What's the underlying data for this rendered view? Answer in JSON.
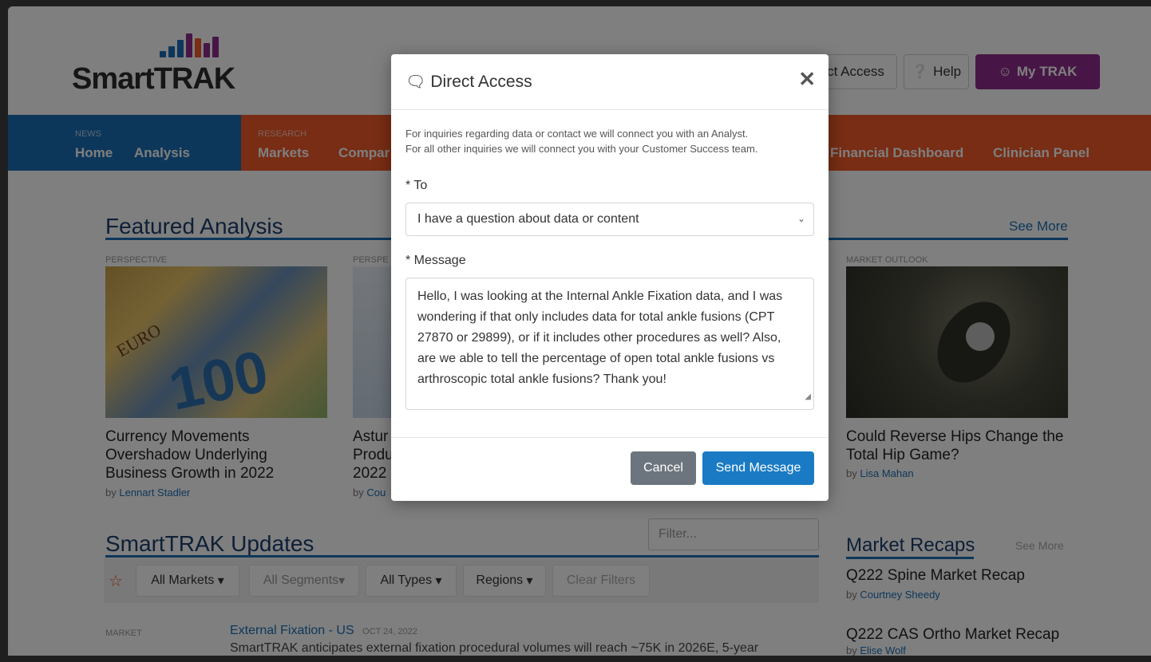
{
  "header": {
    "logo_text": "SmartTRAK",
    "direct_access_label": "ct Access",
    "help_label": "Help",
    "mytrak_label": "My TRAK",
    "colors": {
      "mytrak": "#8e2c8c",
      "nav_blue": "#1a6fb5",
      "nav_orange": "#f05a28"
    }
  },
  "nav": {
    "news_label": "NEWS",
    "research_label": "RESEARCH",
    "items": [
      "Home",
      "Analysis",
      "Markets",
      "Compar",
      "Financial Dashboard",
      "Clinician Panel"
    ]
  },
  "featured": {
    "title": "Featured Analysis",
    "see_more": "See More",
    "cards": [
      {
        "category": "PERSPECTIVE",
        "title": "Currency Movements Overshadow Underlying Business Growth in 2022",
        "by": "by",
        "author": "Lennart Stadler"
      },
      {
        "category": "PERSPE",
        "title": "Astur Produ 2022",
        "by": "by",
        "author": "Cou"
      },
      {
        "category": "MARKET OUTLOOK",
        "title": "Could Reverse Hips Change the Total Hip Game?",
        "by": "by",
        "author": "Lisa Mahan"
      }
    ]
  },
  "updates": {
    "title": "SmartTRAK Updates",
    "filter_placeholder": "Filter...",
    "chips": [
      "All Markets",
      "All Segments",
      "All Types",
      "Regions",
      "Clear Filters"
    ],
    "row": {
      "category": "MARKET",
      "title": "External Fixation - US",
      "date": "OCT 24, 2022",
      "snippet": "SmartTRAK anticipates external fixation procedural volumes will reach ~75K in 2026E, 5-year"
    }
  },
  "recaps": {
    "title": "Market Recaps",
    "see_more": "See More",
    "items": [
      {
        "title": "Q222 Spine Market Recap",
        "by": "by",
        "author": "Courtney Sheedy"
      },
      {
        "title": "Q222 CAS Ortho Market Recap",
        "by": "by",
        "author": "Elise Wolf"
      }
    ]
  },
  "modal": {
    "title": "Direct Access",
    "close": "✕",
    "description_line1": "For inquiries regarding data or contact we will connect you with an Analyst.",
    "description_line2": "For all other inquiries we will connect you with your Customer Success team.",
    "to_label": "* To",
    "to_value": "I have a question about data or content",
    "message_label": "* Message",
    "message_value": "Hello, I was looking at the Internal Ankle Fixation data, and I was wondering if that only includes data for total ankle fusions (CPT 27870 or 29899), or if it includes other procedures as well? Also, are we able to tell the percentage of open total ankle fusions vs arthroscopic total ankle fusions? Thank you!",
    "cancel_label": "Cancel",
    "send_label": "Send Message"
  }
}
